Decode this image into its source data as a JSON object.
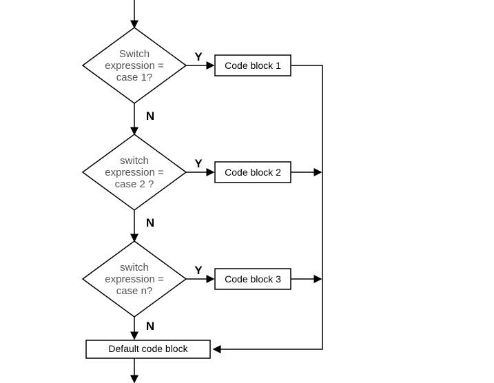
{
  "decisions": [
    {
      "line1": "Switch",
      "line2": "expression =",
      "line3": "case 1?"
    },
    {
      "line1": "switch",
      "line2": "expression =",
      "line3": "case 2 ?"
    },
    {
      "line1": "switch",
      "line2": "expression =",
      "line3": "case n?"
    }
  ],
  "blocks": [
    {
      "label": "Code block 1"
    },
    {
      "label": "Code block 2"
    },
    {
      "label": "Code block 3"
    }
  ],
  "default_block": "Default code block",
  "labels": {
    "yes": "Y",
    "no": "N"
  }
}
